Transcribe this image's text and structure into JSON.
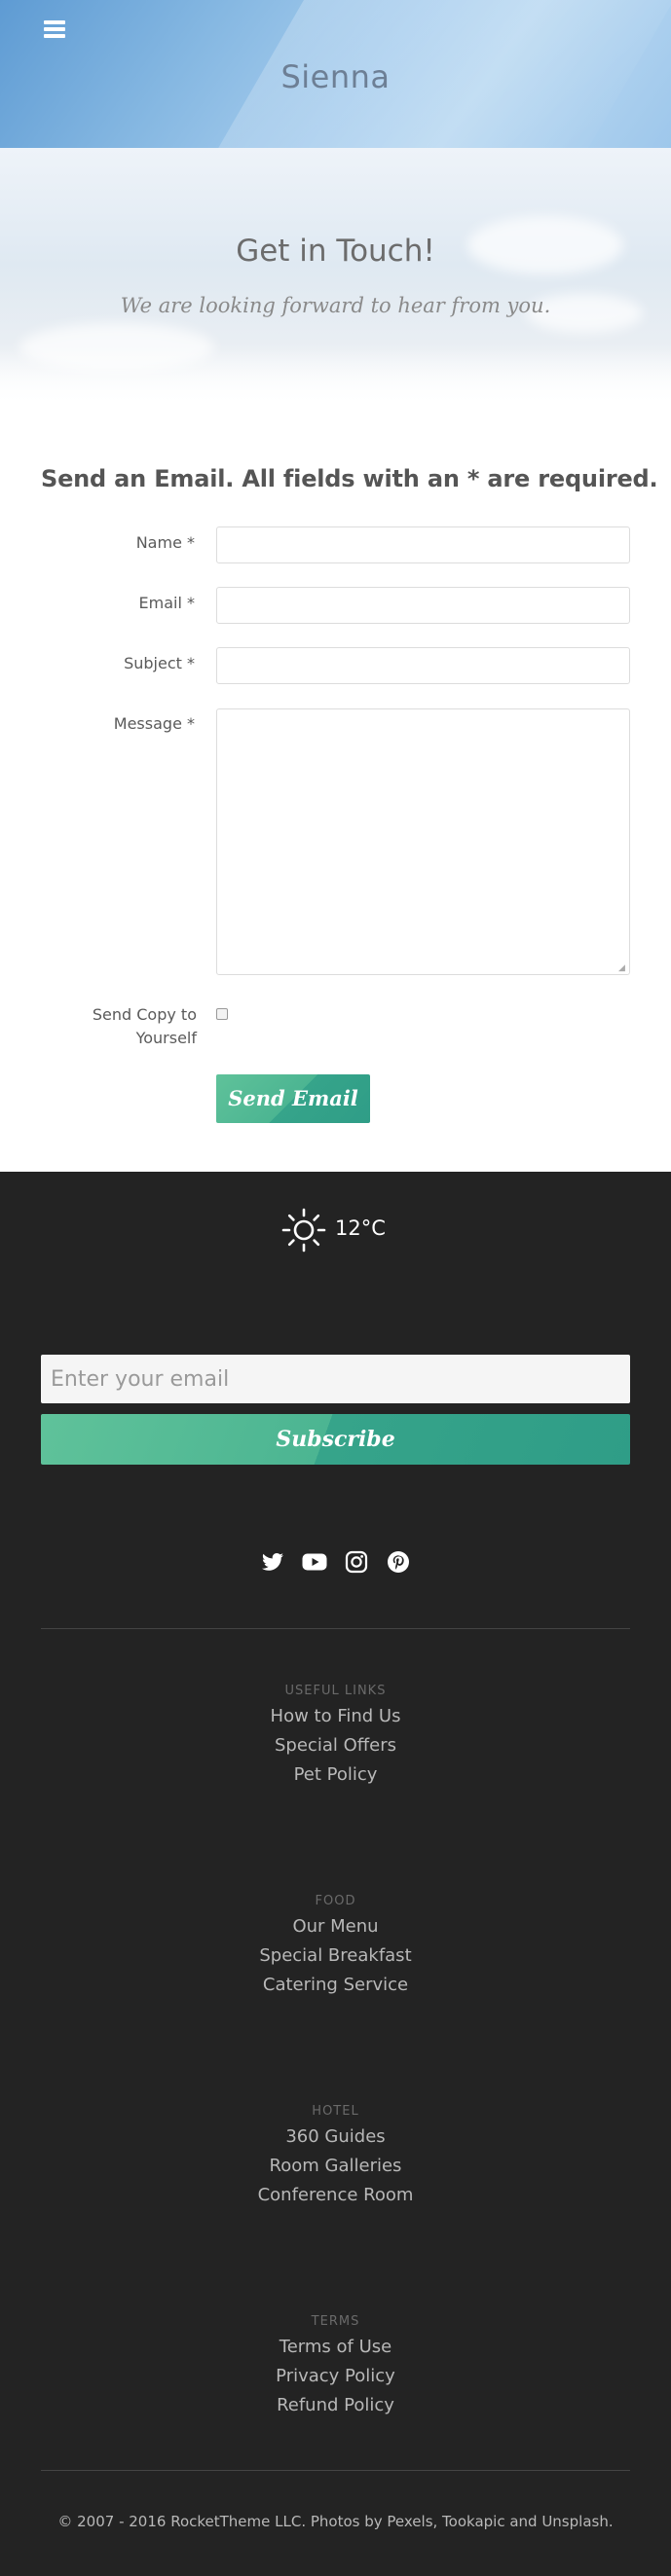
{
  "header": {
    "site_title": "Sienna",
    "menu_icon": "hamburger-menu-icon"
  },
  "hero": {
    "title": "Get in Touch!",
    "subtitle": "We are looking forward to hear from you."
  },
  "form": {
    "title": "Send an Email. All fields with an * are required.",
    "name_label": "Name *",
    "name_value": "",
    "email_label": "Email *",
    "email_value": "",
    "subject_label": "Subject *",
    "subject_value": "",
    "message_label": "Message *",
    "message_value": "",
    "copy_label": "Send Copy to Yourself",
    "copy_checked": false,
    "send_label": "Send Email",
    "button_colors": [
      "#5fc29a",
      "#2f9d87"
    ]
  },
  "footer": {
    "weather": {
      "icon": "sun-icon",
      "temperature": "12°C"
    },
    "newsletter": {
      "email_placeholder": "Enter your email",
      "subscribe_label": "Subscribe"
    },
    "social_icons": [
      "twitter-icon",
      "youtube-icon",
      "instagram-icon",
      "pinterest-icon"
    ],
    "groups": [
      {
        "heading": "Useful Links",
        "links": [
          "How to Find Us",
          "Special Offers",
          "Pet Policy"
        ]
      },
      {
        "heading": "Food",
        "links": [
          "Our Menu",
          "Special Breakfast",
          "Catering Service"
        ]
      },
      {
        "heading": "Hotel",
        "links": [
          "360 Guides",
          "Room Galleries",
          "Conference Room"
        ]
      },
      {
        "heading": "Terms",
        "links": [
          "Terms of Use",
          "Privacy Policy",
          "Refund Policy"
        ]
      }
    ],
    "copyright": "© 2007 - 2016 RocketTheme LLC. Photos by Pexels, Tookapic and Unsplash.",
    "background": "#232323"
  }
}
